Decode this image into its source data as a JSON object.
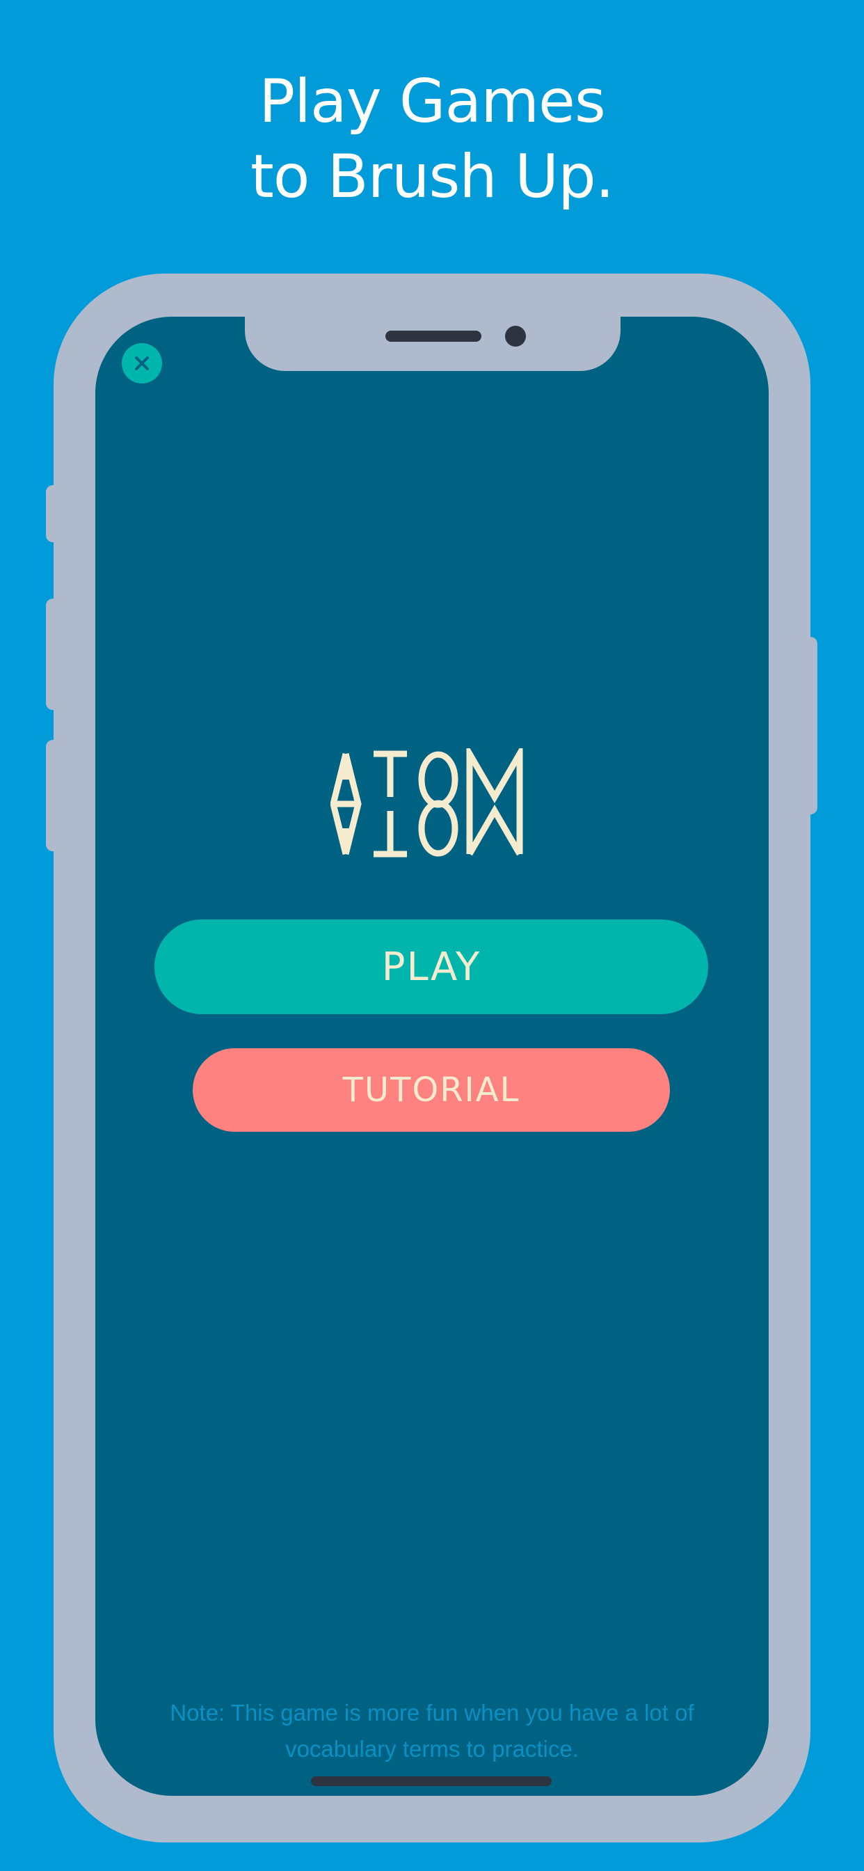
{
  "headline": {
    "line1": "Play Games",
    "line2": "to Brush Up."
  },
  "app": {
    "close_icon": "close-icon",
    "logo": "ATOM",
    "play_label": "PLAY",
    "tutorial_label": "TUTORIAL",
    "note": "Note: This game is more fun when you have a lot of vocabulary terms to practice."
  },
  "colors": {
    "background": "#019bd9",
    "screen": "#006282",
    "phone_frame": "#afbbcc",
    "play_button": "#00b5ac",
    "tutorial_button": "#fe8280",
    "button_text": "#f5eccf",
    "note_text": "#0c8fc2"
  }
}
